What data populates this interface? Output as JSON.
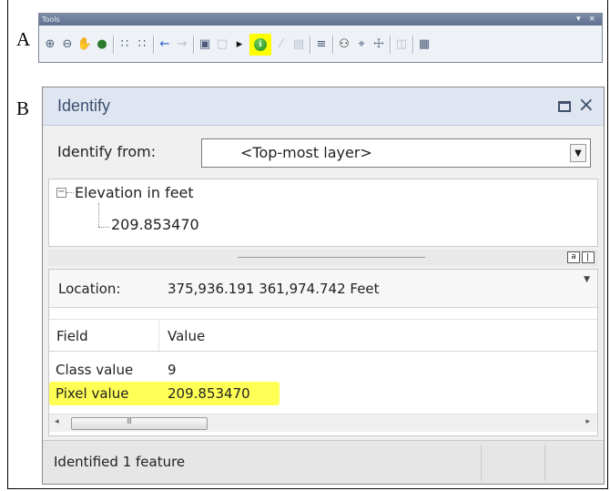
{
  "labels": {
    "panel_a": "A",
    "panel_b": "B"
  },
  "toolbar": {
    "title": "Tools",
    "window_controls": "▾ ×",
    "icons": [
      {
        "name": "zoom-in-icon",
        "glyph": "⊕"
      },
      {
        "name": "zoom-out-icon",
        "glyph": "⊖"
      },
      {
        "name": "pan-hand-icon",
        "glyph": "✋"
      },
      {
        "name": "full-extent-globe-icon",
        "glyph": "●"
      },
      {
        "name": "fixed-zoom-in-icon",
        "glyph": "∷"
      },
      {
        "name": "fixed-zoom-out-icon",
        "glyph": "∷"
      },
      {
        "name": "back-arrow-icon",
        "glyph": "←"
      },
      {
        "name": "forward-arrow-icon",
        "glyph": "→"
      },
      {
        "name": "select-features-icon",
        "glyph": "▣"
      },
      {
        "name": "clear-selection-icon",
        "glyph": "□"
      },
      {
        "name": "select-elements-icon",
        "glyph": "▸"
      },
      {
        "name": "identify-icon",
        "glyph": "i"
      },
      {
        "name": "hyperlink-icon",
        "glyph": "⁄"
      },
      {
        "name": "html-popup-icon",
        "glyph": "▤"
      },
      {
        "name": "measure-icon",
        "glyph": "≡"
      },
      {
        "name": "find-binoculars-icon",
        "glyph": "⚇"
      },
      {
        "name": "find-route-icon",
        "glyph": "⌖"
      },
      {
        "name": "go-to-xy-icon",
        "glyph": "☩"
      },
      {
        "name": "time-slider-icon",
        "glyph": "◫"
      },
      {
        "name": "viewer-window-icon",
        "glyph": "▦"
      }
    ]
  },
  "identify": {
    "title": "Identify",
    "close_glyph": "×",
    "from_label": "Identify from:",
    "from_value": "<Top-most layer>",
    "dropdown_arrow": "▼",
    "tree": {
      "expander": "−",
      "root": "Elevation in feet",
      "child": "209.853470"
    },
    "view_button": "a",
    "location_label": "Location:",
    "location_value": "375,936.191  361,974.742 Feet",
    "pin_glyph": "▼",
    "table": {
      "headers": {
        "field": "Field",
        "value": "Value"
      },
      "rows": [
        {
          "field": "Class value",
          "value": "9"
        },
        {
          "field": "Pixel value",
          "value": "209.853470"
        }
      ]
    },
    "scroll_left": "◂",
    "scroll_right": "▸",
    "status": "Identified 1 feature"
  }
}
